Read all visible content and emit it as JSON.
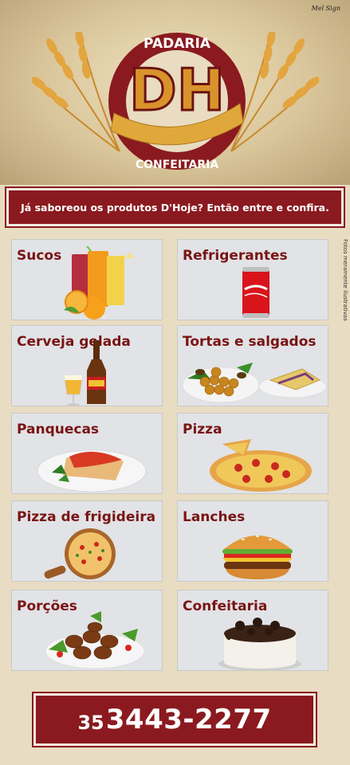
{
  "brand": {
    "top_text": "PADARIA",
    "initials": "DH",
    "bottom_text": "CONFEITARIA",
    "signature": "Mel Sign"
  },
  "tagline": "Já saboreou os produtos D'Hoje? Então entre e confira.",
  "side_note": "Fotos meramente ilustrativas",
  "products": [
    {
      "label": "Sucos"
    },
    {
      "label": "Refrigerantes"
    },
    {
      "label": "Cerveja gelada"
    },
    {
      "label": "Tortas e salgados"
    },
    {
      "label": "Panquecas"
    },
    {
      "label": "Pizza"
    },
    {
      "label": "Pizza de frigideira"
    },
    {
      "label": "Lanches"
    },
    {
      "label": "Porções"
    },
    {
      "label": "Confeitaria"
    }
  ],
  "phone": {
    "area_code": "35",
    "number": "3443-2277"
  },
  "colors": {
    "brand_red": "#8a1a1f",
    "label_red": "#7a1414",
    "gold": "#e0a83a",
    "card_bg": "#e1e3e6"
  }
}
